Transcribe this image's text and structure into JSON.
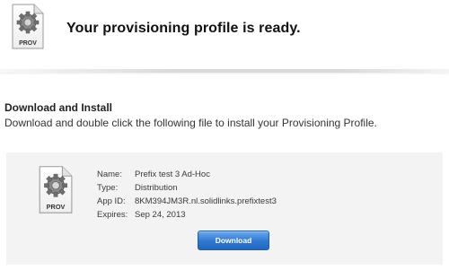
{
  "header": {
    "icon_label": "PROV",
    "title": "Your provisioning profile is ready."
  },
  "section": {
    "title": "Download and Install",
    "description": "Download and double click the following file to install your Provisioning Profile."
  },
  "profile": {
    "icon_label": "PROV",
    "fields": [
      {
        "label": "Name:",
        "value": "Prefix test 3 Ad-Hoc"
      },
      {
        "label": "Type:",
        "value": "Distribution"
      },
      {
        "label": "App ID:",
        "value": "8KM394JM3R.nl.solidlinks.prefixtest3"
      },
      {
        "label": "Expires:",
        "value": "Sep 24, 2013"
      }
    ]
  },
  "download_button": {
    "label": "Download",
    "color": "#2f78d0"
  },
  "icons": {
    "file_icon": "gear-document-icon"
  }
}
